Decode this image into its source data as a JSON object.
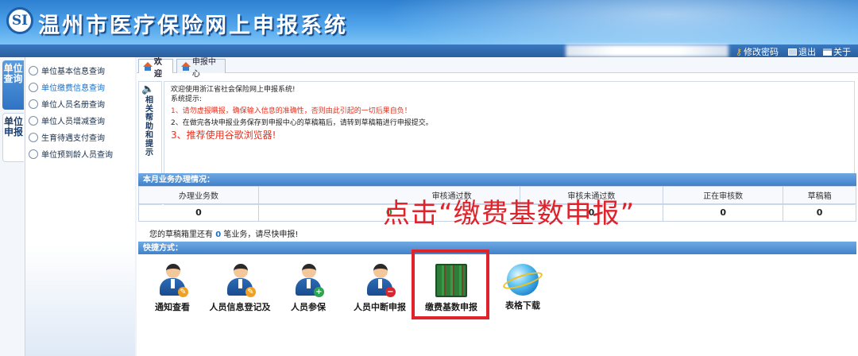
{
  "header": {
    "logo_text": "SI",
    "title": "温州市医疗保险网上申报系统"
  },
  "topbar": {
    "change_password": "修改密码",
    "logout": "退出",
    "about": "关于"
  },
  "sidebar": {
    "vertical_tabs": [
      {
        "label": "单位查询"
      },
      {
        "label": "单位申报"
      }
    ],
    "items": [
      {
        "label": "单位基本信息查询"
      },
      {
        "label": "单位缴费信息查询"
      },
      {
        "label": "单位人员名册查询"
      },
      {
        "label": "单位人员增减查询"
      },
      {
        "label": "生育待遇支付查询"
      },
      {
        "label": "单位预到龄人员查询"
      }
    ]
  },
  "tabs": [
    {
      "label": "欢迎"
    },
    {
      "label": "申报中心"
    }
  ],
  "help": {
    "label": "相关帮助和提示"
  },
  "notice": {
    "line1": "欢迎使用浙江省社会保险网上申报系统!",
    "line2": "系统提示:",
    "line3": "1、请勿虚报瞒报，确保输入信息的准确性，否则由此引起的一切后果自负！",
    "line4": "2、在做完各块申报业务保存到申报中心的草稿箱后，请转到草稿箱进行申报提交。",
    "line5": "3、推荐使用谷歌浏览器!"
  },
  "stats": {
    "section_title": "本月业务办理情况：",
    "headers": [
      "办理业务数",
      "审核通过数",
      "审核未通过数",
      "正在审核数",
      "草稿箱"
    ],
    "values": [
      "0",
      "0",
      "0",
      "0",
      "0"
    ],
    "reminder_prefix": "您的草稿箱里还有",
    "reminder_count": "0",
    "reminder_suffix": "笔业务，请尽快申报!"
  },
  "shortcuts": {
    "section_title": "快捷方式：",
    "items": [
      {
        "label": "通知查看",
        "icon": "notice-person-icon"
      },
      {
        "label": "人员信息登记及",
        "icon": "register-person-icon"
      },
      {
        "label": "人员参保",
        "icon": "insure-person-icon"
      },
      {
        "label": "人员中断申报",
        "icon": "interrupt-person-icon"
      },
      {
        "label": "缴费基数申报",
        "icon": "books-icon"
      },
      {
        "label": "表格下载",
        "icon": "globe-icon"
      }
    ]
  },
  "annotation": {
    "text": "点击“缴费基数申报”",
    "color": "#e0232b"
  },
  "colors": {
    "banner": "#3a8ad8",
    "accent": "#1a6fc4",
    "warning": "#e5301e"
  }
}
